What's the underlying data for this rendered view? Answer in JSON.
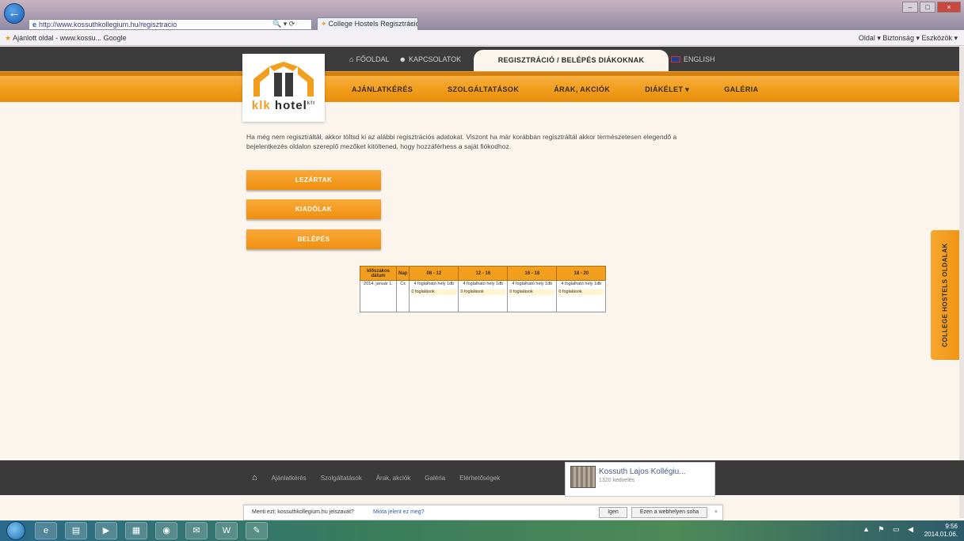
{
  "browser": {
    "address": "http://www.kossuthkollegium.hu/regisztracio",
    "tab_title": "College Hostels Regisztráció",
    "favorites_text": "Ajánlott oldal - www.kossu... Google ",
    "toolbar_right": "Oldal ▾  Biztonság ▾  Eszközök ▾"
  },
  "topnav": {
    "links": [
      {
        "icon": "home-icon",
        "label": "FŐOLDAL"
      },
      {
        "icon": "user-icon",
        "label": "KAPCSOLATOK"
      }
    ],
    "register_tab": "REGISZTRÁCIÓ / BELÉPÉS DIÁKOKNAK",
    "language": "ENGLISH"
  },
  "menu": [
    "AJÁNLATKÉRÉS",
    "SZOLGÁLTATÁSOK",
    "ÁRAK, AKCIÓK",
    "DIÁKÉLET ▾",
    "GALÉRIA"
  ],
  "logo": {
    "text_a": "klk",
    "text_b": " hotel",
    "suffix": "kft"
  },
  "intro": "Ha még nem regisztráltál, akkor töltsd ki az alábbi regisztrációs adatokat. Viszont ha már korábban regisztráltál akkor természetesen elegendő a bejelentkezés oldalon szereplő mezőket kitöltened, hogy hozzáférhess a saját fiókodhoz.",
  "buttons": [
    "LEZÁRTAK",
    "KIADÓLAK",
    "BELÉPÉS"
  ],
  "schedule": {
    "headers": [
      "Időszakos dátum",
      "Nap",
      "08 - 12",
      "12 - 16",
      "16 - 18",
      "18 - 20"
    ],
    "row": {
      "date": "2014. január 1.",
      "day": "Cs",
      "slots": [
        {
          "text": "4 foglalható hely 1db",
          "status": "0 foglalások"
        },
        {
          "text": "4 foglalható hely 1db",
          "status": "0 foglalások"
        },
        {
          "text": "4 foglalható hely 1db",
          "status": "0 foglalások"
        },
        {
          "text": "4 foglalható hely 1db",
          "status": "0 foglalások"
        }
      ]
    }
  },
  "sidetab": "COLLEGE HOSTELS OLDALAK",
  "footer": {
    "links": [
      "Ajánlatkérés",
      "Szolgáltatások",
      "Árak, akciók",
      "Galéria",
      "Elérhetőségek"
    ],
    "fb_name": "Kossuth Lajos Kollégiu...",
    "fb_sub": "1320 kedvelés"
  },
  "notification": {
    "question": "Menti ezt: kossuthkollegium.hu jelszavát?",
    "more": "Mióta jelent ez meg?",
    "yes": "Igen",
    "no": "Ezen a webhelyen soha"
  },
  "taskbar": {
    "icons": [
      "ie-icon",
      "folder-icon",
      "media-icon",
      "calc-icon",
      "chrome-icon",
      "outlook-icon",
      "word-icon",
      "paint-icon"
    ],
    "time": "9:56",
    "date": "2014.01.06."
  }
}
